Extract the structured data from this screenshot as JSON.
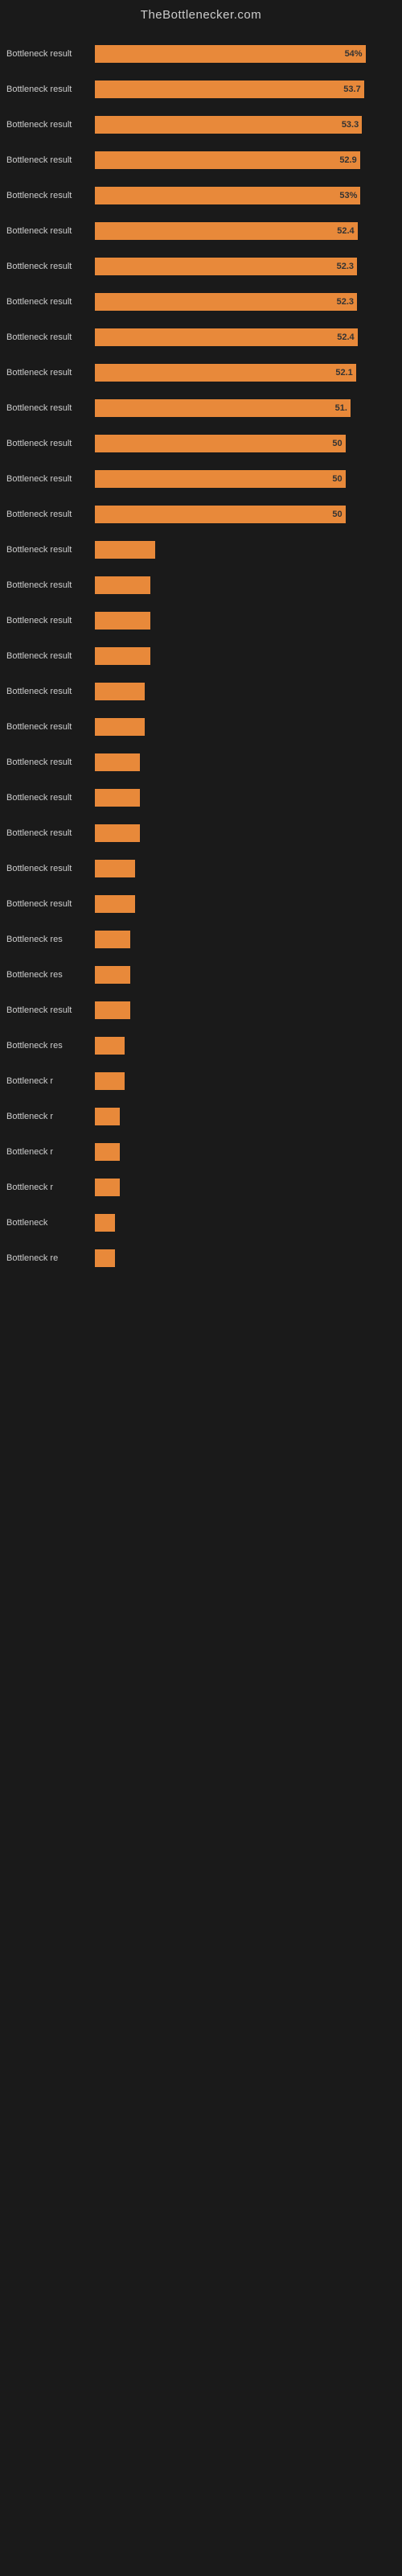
{
  "header": {
    "title": "TheBottlenecker.com"
  },
  "bars": [
    {
      "label": "Bottleneck result",
      "value": 54.0,
      "display": "54%",
      "width_pct": 54
    },
    {
      "label": "Bottleneck result",
      "value": 53.7,
      "display": "53.7",
      "width_pct": 53.7
    },
    {
      "label": "Bottleneck result",
      "value": 53.3,
      "display": "53.3",
      "width_pct": 53.3
    },
    {
      "label": "Bottleneck result",
      "value": 52.9,
      "display": "52.9",
      "width_pct": 52.9
    },
    {
      "label": "Bottleneck result",
      "value": 53.0,
      "display": "53%",
      "width_pct": 53
    },
    {
      "label": "Bottleneck result",
      "value": 52.4,
      "display": "52.4",
      "width_pct": 52.4
    },
    {
      "label": "Bottleneck result",
      "value": 52.3,
      "display": "52.3",
      "width_pct": 52.3
    },
    {
      "label": "Bottleneck result",
      "value": 52.3,
      "display": "52.3",
      "width_pct": 52.3
    },
    {
      "label": "Bottleneck result",
      "value": 52.4,
      "display": "52.4",
      "width_pct": 52.4
    },
    {
      "label": "Bottleneck result",
      "value": 52.1,
      "display": "52.1",
      "width_pct": 52.1
    },
    {
      "label": "Bottleneck result",
      "value": 51.0,
      "display": "51.",
      "width_pct": 51
    },
    {
      "label": "Bottleneck result",
      "value": 50.0,
      "display": "50",
      "width_pct": 50
    },
    {
      "label": "Bottleneck result",
      "value": 50.0,
      "display": "50",
      "width_pct": 50
    },
    {
      "label": "Bottleneck result",
      "value": 50.0,
      "display": "50",
      "width_pct": 50
    },
    {
      "label": "Bottleneck result",
      "value": 12,
      "display": "",
      "width_pct": 12
    },
    {
      "label": "Bottleneck result",
      "value": 11,
      "display": "",
      "width_pct": 11
    },
    {
      "label": "Bottleneck result",
      "value": 11,
      "display": "",
      "width_pct": 11
    },
    {
      "label": "Bottleneck result",
      "value": 11,
      "display": "",
      "width_pct": 11
    },
    {
      "label": "Bottleneck result",
      "value": 10,
      "display": "",
      "width_pct": 10
    },
    {
      "label": "Bottleneck result",
      "value": 10,
      "display": "",
      "width_pct": 10
    },
    {
      "label": "Bottleneck result",
      "value": 9,
      "display": "",
      "width_pct": 9
    },
    {
      "label": "Bottleneck result",
      "value": 9,
      "display": "",
      "width_pct": 9
    },
    {
      "label": "Bottleneck result",
      "value": 9,
      "display": "",
      "width_pct": 9
    },
    {
      "label": "Bottleneck result",
      "value": 8,
      "display": "",
      "width_pct": 8
    },
    {
      "label": "Bottleneck result",
      "value": 8,
      "display": "",
      "width_pct": 8
    },
    {
      "label": "Bottleneck res",
      "value": 7,
      "display": "",
      "width_pct": 7
    },
    {
      "label": "Bottleneck res",
      "value": 7,
      "display": "",
      "width_pct": 7
    },
    {
      "label": "Bottleneck result",
      "value": 7,
      "display": "",
      "width_pct": 7
    },
    {
      "label": "Bottleneck res",
      "value": 6,
      "display": "",
      "width_pct": 6
    },
    {
      "label": "Bottleneck r",
      "value": 6,
      "display": "",
      "width_pct": 6
    },
    {
      "label": "Bottleneck r",
      "value": 5,
      "display": "",
      "width_pct": 5
    },
    {
      "label": "Bottleneck r",
      "value": 5,
      "display": "",
      "width_pct": 5
    },
    {
      "label": "Bottleneck r",
      "value": 5,
      "display": "",
      "width_pct": 5
    },
    {
      "label": "Bottleneck",
      "value": 4,
      "display": "",
      "width_pct": 4
    },
    {
      "label": "Bottleneck re",
      "value": 4,
      "display": "",
      "width_pct": 4
    }
  ]
}
